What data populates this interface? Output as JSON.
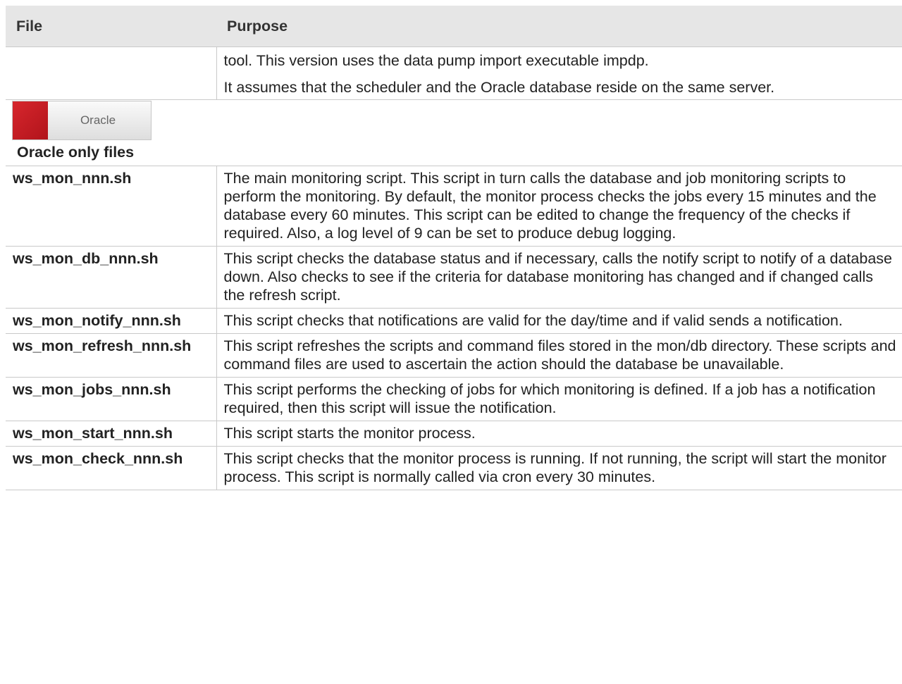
{
  "table": {
    "headers": {
      "file": "File",
      "purpose": "Purpose"
    },
    "continued_row": {
      "file": "",
      "paragraphs": [
        "tool. This version uses the data pump import executable impdp.",
        "It assumes that the scheduler and the Oracle database reside on the same server."
      ]
    },
    "section": {
      "badge_label": "Oracle",
      "title": "Oracle only files",
      "badge_color": "#c81e25"
    },
    "rows": [
      {
        "file": "ws_mon_nnn.sh",
        "purpose": "The main monitoring script. This script in turn calls the database and job monitoring scripts to perform the monitoring. By default, the monitor process checks the jobs every 15 minutes and the database every 60 minutes. This script can be edited to change the frequency of the checks if required. Also, a log level of 9 can be set to produce debug logging."
      },
      {
        "file": "ws_mon_db_nnn.sh",
        "purpose": "This script checks the database status and if necessary, calls the notify script to notify of a database down. Also checks to see if the criteria for database monitoring has changed and if changed calls the refresh script."
      },
      {
        "file": "ws_mon_notify_nnn.sh",
        "purpose": "This script checks that notifications are valid for the day/time and if valid sends a notification."
      },
      {
        "file": "ws_mon_refresh_nnn.sh",
        "purpose": "This script refreshes the scripts and command files stored in the mon/db directory. These scripts and command files are used to ascertain the action should the database be unavailable."
      },
      {
        "file": "ws_mon_jobs_nnn.sh",
        "purpose": "This script performs the checking of jobs for which monitoring is defined. If a job has a notification required, then this script will issue the notification."
      },
      {
        "file": "ws_mon_start_nnn.sh",
        "purpose": "This script starts the monitor process."
      },
      {
        "file": "ws_mon_check_nnn.sh",
        "purpose": "This script checks that the monitor process is running. If not running, the script will start the monitor process. This script is normally called via cron every 30 minutes."
      }
    ]
  }
}
